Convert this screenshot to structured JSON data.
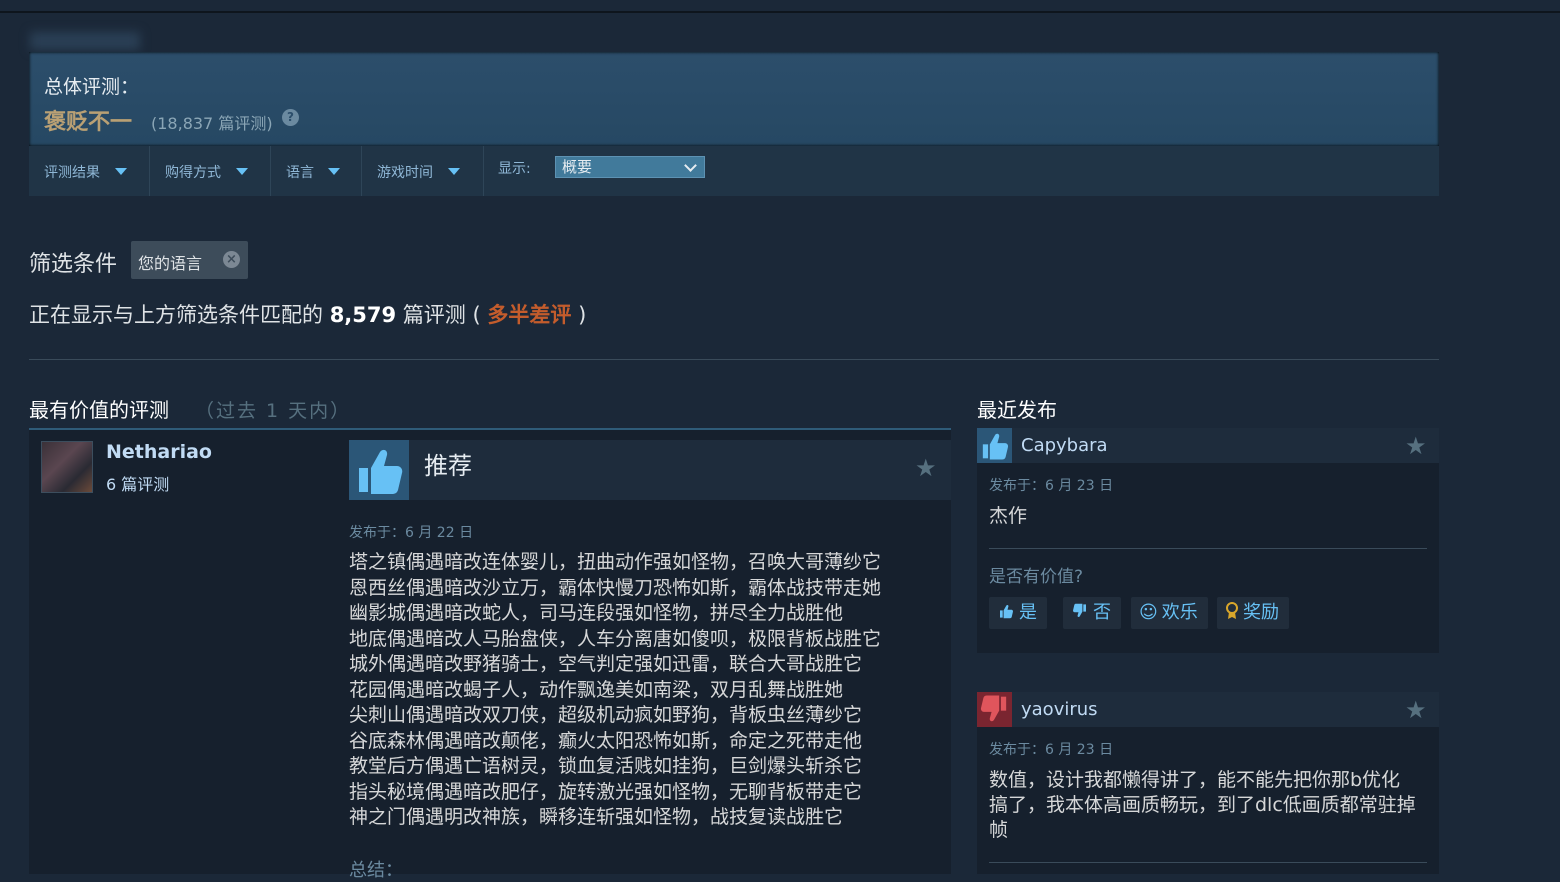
{
  "overall": {
    "label": "总体评测：",
    "summary": "褒贬不一",
    "count": "(18,837 篇评测)",
    "help": "?"
  },
  "filterbar": {
    "items": [
      {
        "label": "评测结果"
      },
      {
        "label": "购得方式"
      },
      {
        "label": "语言"
      },
      {
        "label": "游戏时间"
      }
    ],
    "show_label": "显示:",
    "show_value": "概要"
  },
  "active_filters": {
    "title": "筛选条件",
    "chip": "您的语言"
  },
  "match": {
    "prefix": "正在显示与上方筛选条件匹配的",
    "count": "8,579",
    "suffix": "篇评测 (",
    "summary": "多半差评",
    "close": ")"
  },
  "left": {
    "title": "最有价值的评测",
    "subtitle": "（过去 1 天内）",
    "review": {
      "author": "Nethariao",
      "author_reviews": "6 篇评测",
      "verdict": "推荐",
      "posted": "发布于：6 月 22 日",
      "lines": [
        "塔之镇偶遇暗改连体婴儿，扭曲动作强如怪物，召唤大哥薄纱它",
        "恩西丝偶遇暗改沙立万，霸体快慢刀恐怖如斯，霸体战技带走她",
        "幽影城偶遇暗改蛇人，司马连段强如怪物，拼尽全力战胜他",
        "地底偶遇暗改人马胎盘侠，人车分离唐如傻呗，极限背板战胜它",
        "城外偶遇暗改野猪骑士，空气判定强如迅雷，联合大哥战胜它",
        "花园偶遇暗改蝎子人，动作飘逸美如南梁，双月乱舞战胜她",
        "尖刺山偶遇暗改双刀侠，超级机动疯如野狗，背板虫丝薄纱它",
        "谷底森林偶遇暗改颠佬，癫火太阳恐怖如斯，命定之死带走他",
        "教堂后方偶遇亡语树灵，锁血复活贱如挂狗，巨剑爆头斩杀它",
        "指头秘境偶遇暗改肥仔，旋转激光强如怪物，无聊背板带走它",
        "神之门偶遇明改神族，瞬移连斩强如怪物，战技复读战胜它"
      ],
      "summary_label": "总结："
    }
  },
  "right": {
    "title": "最近发布",
    "reviews": [
      {
        "author": "Capybara",
        "posted": "发布于：6 月 23 日",
        "text": "杰作",
        "helpful_q": "是否有价值?",
        "votes": [
          {
            "icon": "thumbs-up",
            "label": "是"
          },
          {
            "icon": "thumbs-down",
            "label": "否"
          },
          {
            "icon": "smile",
            "label": "欢乐"
          },
          {
            "icon": "award",
            "label": "奖励"
          }
        ]
      },
      {
        "author": "yaovirus",
        "posted": "发布于：6 月 23 日",
        "lines": [
          "数值，设计我都懒得讲了，能不能先把你那b优化",
          "搞了，我本体高画质畅玩，到了dlc低画质都常驻掉",
          "帧"
        ]
      }
    ]
  },
  "colors": {
    "background": "#1b2838",
    "mixed": "#b9a074",
    "negative": "#c35c2c",
    "accent": "#67c1f5"
  }
}
